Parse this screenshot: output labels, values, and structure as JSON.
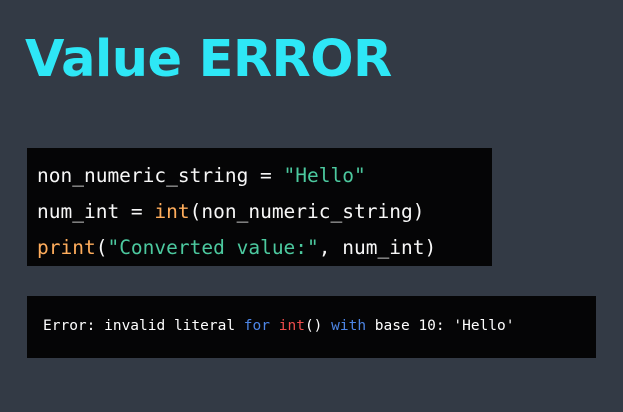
{
  "slide": {
    "title": "Value ERROR",
    "colors": {
      "background": "#333a45",
      "title": "#2ee7f6",
      "code_background": "#050506",
      "string": "#4cc99f",
      "function": "#ffad5c",
      "keyword": "#4d86e7",
      "error_function": "#ef4c4c"
    }
  },
  "code": {
    "line1": {
      "var_eq": "non_numeric_string = ",
      "string": "\"Hello\""
    },
    "line2": {
      "prefix": "num_int = ",
      "func": "int",
      "args": "(non_numeric_string)"
    },
    "line3": {
      "func": "print",
      "open": "(",
      "string": "\"Converted value:\"",
      "rest": ", num_int)"
    }
  },
  "error": {
    "prefix": "Error: invalid literal ",
    "kw_for": "for",
    "space1": " ",
    "func": "int",
    "parens": "()",
    "space2": " ",
    "kw_with": "with",
    "suffix": " base 10: 'Hello'"
  }
}
